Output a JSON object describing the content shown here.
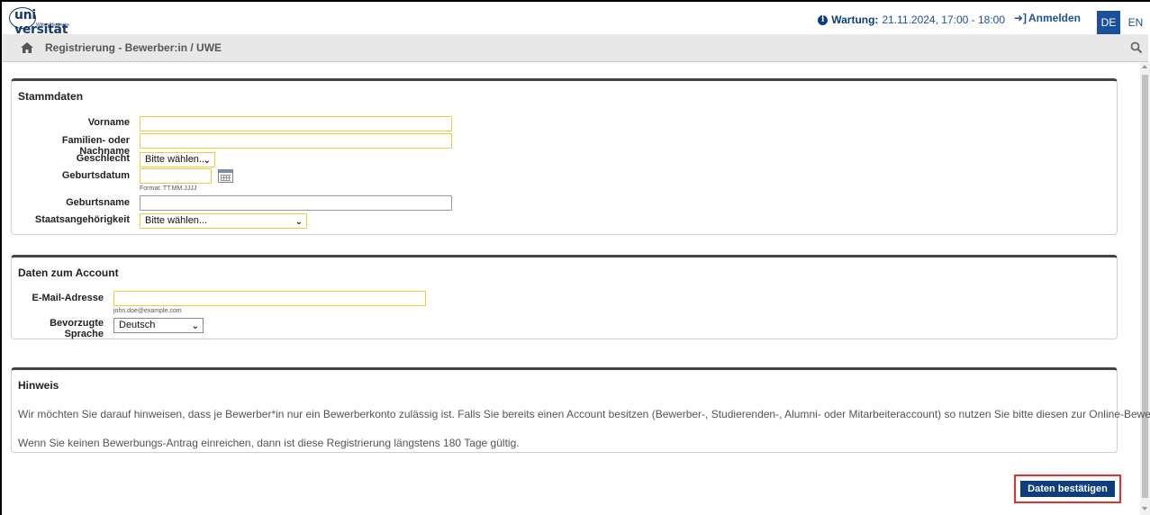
{
  "header": {
    "logo_text": "uni versität",
    "logo_sub": "Witten/Herdecke",
    "maintenance_label": "Wartung:",
    "maintenance_value": "21.11.2024, 17:00 - 18:00",
    "login_label": "Anmelden",
    "lang_de": "DE",
    "lang_en": "EN"
  },
  "breadcrumb": {
    "text": "Registrierung - Bewerber:in  / UWE"
  },
  "stammdaten": {
    "title": "Stammdaten",
    "vorname_label": "Vorname",
    "vorname_value": "",
    "nachname_label": "Familien- oder Nachname",
    "nachname_value": "",
    "geschlecht_label": "Geschlecht",
    "geschlecht_value": "Bitte wählen...",
    "geburtsdatum_label": "Geburtsdatum",
    "geburtsdatum_value": "",
    "geburtsdatum_hint": "Format: TT.MM.JJJJ",
    "geburtsname_label": "Geburtsname",
    "geburtsname_value": "",
    "staat_label": "Staatsangehörigkeit",
    "staat_value": "Bitte wählen..."
  },
  "account": {
    "title": "Daten zum Account",
    "email_label": "E-Mail-Adresse",
    "email_value": "",
    "email_hint": "john.doe@example.com",
    "sprache_label": "Bevorzugte Sprache",
    "sprache_value": "Deutsch"
  },
  "hinweis": {
    "title": "Hinweis",
    "text1": "Wir möchten Sie darauf hinweisen, dass je Bewerber*in nur ein Bewerberkonto zulässig ist. Falls Sie bereits einen Account besitzen (Bewerber-, Studierenden-, Alumni- oder Mitarbeiteraccount) so nutzen Sie bitte diesen zur Online-Bewerbung.",
    "text2": "Wenn Sie keinen Bewerbungs-Antrag einreichen, dann ist diese Registrierung längstens 180 Tage gültig."
  },
  "actions": {
    "confirm_label": "Daten bestätigen"
  }
}
